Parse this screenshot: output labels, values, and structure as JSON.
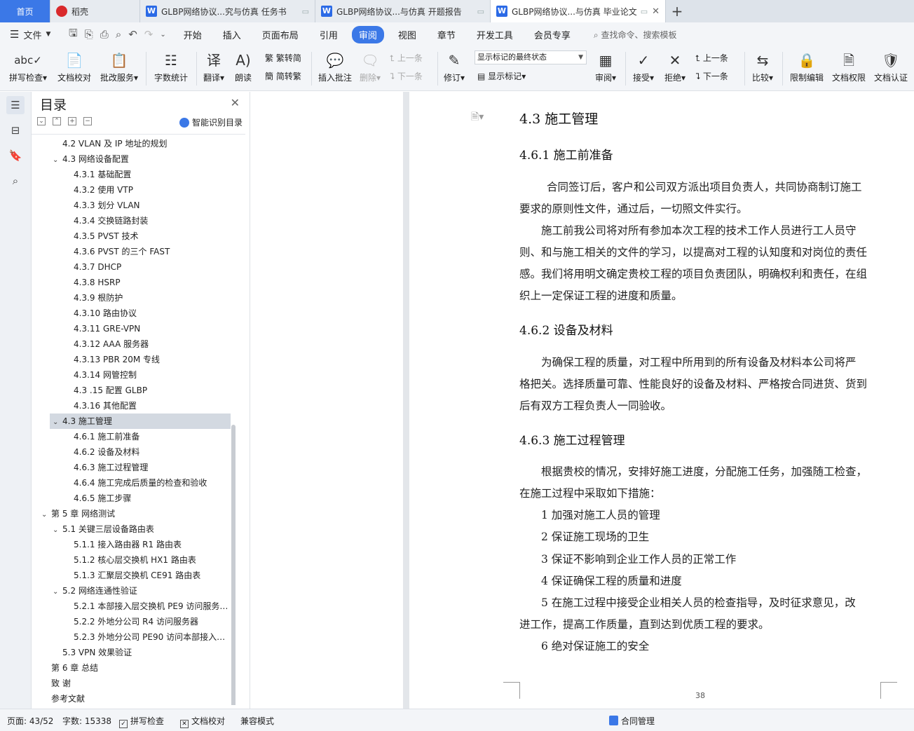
{
  "tabs": [
    {
      "label": "首页"
    },
    {
      "label": "稻壳"
    },
    {
      "label": "GLBP网络协议...究与仿真 任务书"
    },
    {
      "label": "GLBP网络协议...与仿真 开题报告"
    },
    {
      "label": "GLBP网络协议...与仿真 毕业论文"
    }
  ],
  "menubar": {
    "file": "文件",
    "items": [
      "开始",
      "插入",
      "页面布局",
      "引用",
      "审阅",
      "视图",
      "章节",
      "开发工具",
      "会员专享"
    ],
    "active": "审阅",
    "search": "查找命令、搜索模板"
  },
  "ribbon": {
    "spell": "拼写检查",
    "proofread": "文档校对",
    "correct": "批改服务",
    "wordcount": "字数统计",
    "translate": "翻译",
    "read": "朗读",
    "to_simplified": "繁转简",
    "to_traditional": "简转繁",
    "insert_comment": "插入批注",
    "delete": "删除",
    "prev_comment": "上一条",
    "next_comment": "下一条",
    "revise": "修订",
    "display_state": "显示标记的最终状态",
    "show_marks": "显示标记",
    "review": "审阅",
    "accept": "接受",
    "reject": "拒绝",
    "prev_change": "上一条",
    "next_change": "下一条",
    "compare": "比较",
    "restrict_edit": "限制编辑",
    "doc_permission": "文档权限",
    "doc_cert": "文档认证"
  },
  "toc": {
    "title": "目录",
    "smart": "智能识别目录",
    "items": [
      {
        "text": "4.2 VLAN 及 IP 地址的规划",
        "level": 2,
        "arrow": ""
      },
      {
        "text": "4.3 网络设备配置",
        "level": 2,
        "arrow": "v"
      },
      {
        "text": "4.3.1  基础配置",
        "level": 3,
        "arrow": ""
      },
      {
        "text": "4.3.2  使用 VTP",
        "level": 3,
        "arrow": ""
      },
      {
        "text": "4.3.3  划分 VLAN",
        "level": 3,
        "arrow": ""
      },
      {
        "text": "4.3.4  交换链路封装",
        "level": 3,
        "arrow": ""
      },
      {
        "text": "4.3.5 PVST 技术",
        "level": 3,
        "arrow": ""
      },
      {
        "text": "4.3.6 PVST 的三个 FAST",
        "level": 3,
        "arrow": ""
      },
      {
        "text": "4.3.7 DHCP",
        "level": 3,
        "arrow": ""
      },
      {
        "text": "4.3.8 HSRP",
        "level": 3,
        "arrow": ""
      },
      {
        "text": "4.3.9  根防护",
        "level": 3,
        "arrow": ""
      },
      {
        "text": "4.3.10  路由协议",
        "level": 3,
        "arrow": ""
      },
      {
        "text": "4.3.11 GRE-VPN",
        "level": 3,
        "arrow": ""
      },
      {
        "text": "4.3.12 AAA 服务器",
        "level": 3,
        "arrow": ""
      },
      {
        "text": "4.3.13 PBR 20M 专线",
        "level": 3,
        "arrow": ""
      },
      {
        "text": "4.3.14  网管控制",
        "level": 3,
        "arrow": ""
      },
      {
        "text": "4.3 .15 配置 GLBP",
        "level": 3,
        "arrow": ""
      },
      {
        "text": "4.3.16 其他配置",
        "level": 3,
        "arrow": ""
      },
      {
        "text": "4.3  施工管理",
        "level": 2,
        "arrow": "v",
        "selected": true
      },
      {
        "text": "4.6.1  施工前准备",
        "level": 3,
        "arrow": ""
      },
      {
        "text": "4.6.2  设备及材料",
        "level": 3,
        "arrow": ""
      },
      {
        "text": "4.6.3  施工过程管理",
        "level": 3,
        "arrow": ""
      },
      {
        "text": "4.6.4  施工完成后质量的检查和验收",
        "level": 3,
        "arrow": ""
      },
      {
        "text": "4.6.5  施工步骤",
        "level": 3,
        "arrow": ""
      },
      {
        "text": "第 5 章  网络测试",
        "level": 1,
        "arrow": "v"
      },
      {
        "text": "5.1  关键三层设备路由表",
        "level": 2,
        "arrow": "v"
      },
      {
        "text": "5.1.1  接入路由器 R1 路由表",
        "level": 3,
        "arrow": ""
      },
      {
        "text": "5.1.2  核心层交换机 HX1 路由表",
        "level": 3,
        "arrow": ""
      },
      {
        "text": "5.1.3  汇聚层交换机 CE91 路由表",
        "level": 3,
        "arrow": ""
      },
      {
        "text": "5.2 网络连通性验证",
        "level": 2,
        "arrow": "v"
      },
      {
        "text": "5.2.1  本部接入层交换机 PE9 访问服务…",
        "level": 3,
        "arrow": ""
      },
      {
        "text": "5.2.2  外地分公司 R4 访问服务器",
        "level": 3,
        "arrow": ""
      },
      {
        "text": "5.2.3  外地分公司 PE90 访问本部接入…",
        "level": 3,
        "arrow": ""
      },
      {
        "text": "5.3 VPN 效果验证",
        "level": 2,
        "arrow": ""
      },
      {
        "text": "第 6 章  总结",
        "level": 1,
        "arrow": ""
      },
      {
        "text": "致    谢",
        "level": 1,
        "arrow": ""
      },
      {
        "text": "参考文献",
        "level": 1,
        "arrow": ""
      }
    ]
  },
  "doc": {
    "h_43": "4.3  施工管理",
    "h_461": "4.6.1  施工前准备",
    "p1_l1": "合同签订后，客户和公司双方派出项目负责人，共同协商制订施工",
    "p1_l2": "要求的原则性文件，通过后，一切照文件实行。",
    "p2_l1": "施工前我公司将对所有参加本次工程的技术工作人员进行工人员守",
    "p2_l2": "则、和与施工相关的文件的学习，以提高对工程的认知度和对岗位的责任",
    "p2_l3": "感。我们将用明文确定贵校工程的项目负责团队，明确权利和责任，在组",
    "p2_l4": "织上一定保证工程的进度和质量。",
    "h_462": "4.6.2  设备及材料",
    "p3_l1": "为确保工程的质量，对工程中所用到的所有设备及材料本公司将严",
    "p3_l2": "格把关。选择质量可靠、性能良好的设备及材料、严格按合同进货、货到",
    "p3_l3": "后有双方工程负责人一同验收。",
    "h_463": "4.6.3  施工过程管理",
    "p4_l1": "根据贵校的情况，安排好施工进度，分配施工任务，加强随工检查，",
    "p4_l2": "在施工过程中采取如下措施：",
    "li1": "1  加强对施工人员的管理",
    "li2": "2 保证施工现场的卫生",
    "li3": "3 保证不影响到企业工作人员的正常工作",
    "li4": "4 保证确保工程的质量和进度",
    "li5_l1": "5  在施工过程中接受企业相关人员的检查指导，及时征求意见，改",
    "li5_l2": "进工作，提高工作质量，直到达到优质工程的要求。",
    "li6": "6 绝对保证施工的安全",
    "page_number": "38"
  },
  "status": {
    "page": "页面: 43/52",
    "words": "字数: 15338",
    "spell": "拼写检查",
    "proofread": "文档校对",
    "compat": "兼容模式",
    "contract": "合同管理"
  },
  "colors": {
    "accent": "#3b78e7",
    "selected_toc": "#d3d9e1"
  }
}
